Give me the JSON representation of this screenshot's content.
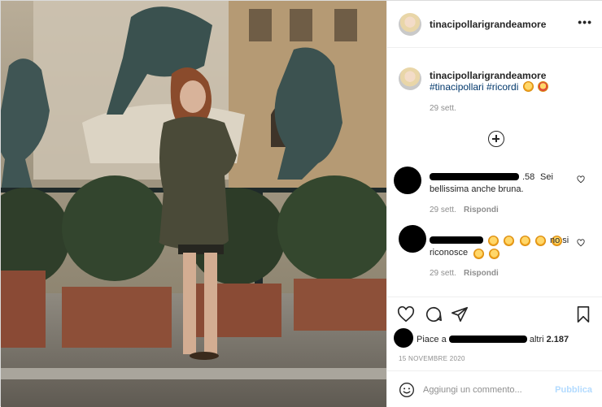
{
  "post": {
    "username": "tinacipollarigrandeamore",
    "more_icon": "more-horizontal-icon",
    "caption": {
      "username": "tinacipollarigrandeamore",
      "hashtags": "#tinacipollari #ricordi",
      "time": "29 sett."
    },
    "load_more_icon": "plus-circle-icon",
    "comments": [
      {
        "username_suffix": ".58",
        "text_line1": "Sei",
        "text_line2": "bellissima anche bruna.",
        "time": "29 sett.",
        "reply_label": "Rispondi"
      },
      {
        "text_line1": "no si",
        "text_line2": "riconosce",
        "time": "29 sett.",
        "reply_label": "Rispondi"
      }
    ],
    "likes": {
      "prefix": "Piace a",
      "suffix_label": "altri",
      "count": "2.187"
    },
    "date": "15 NOVEMBRE 2020",
    "add_comment": {
      "placeholder": "Aggiungi un commento...",
      "publish_label": "Pubblica"
    },
    "colors": {
      "link": "#00376b",
      "muted": "#8e8e8e",
      "publish_disabled": "#b3dbff"
    }
  }
}
